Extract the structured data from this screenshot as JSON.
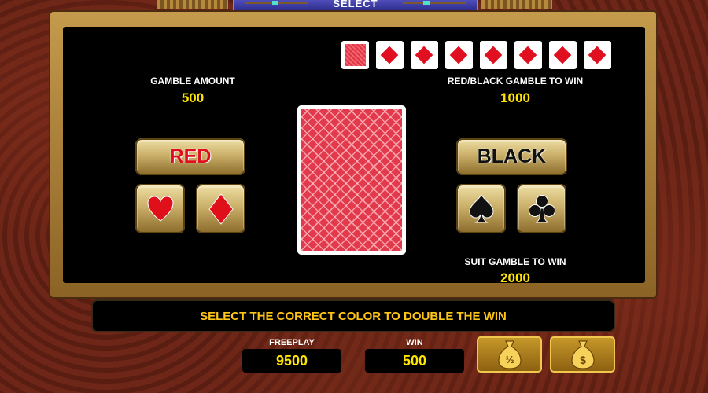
{
  "header": {
    "title": "SELECT"
  },
  "history_cards": [
    {
      "kind": "back"
    },
    {
      "kind": "diamond"
    },
    {
      "kind": "diamond"
    },
    {
      "kind": "diamond"
    },
    {
      "kind": "diamond"
    },
    {
      "kind": "diamond"
    },
    {
      "kind": "diamond"
    },
    {
      "kind": "diamond"
    }
  ],
  "gamble_amount": {
    "label": "GAMBLE AMOUNT",
    "value": "500"
  },
  "red_black": {
    "label": "RED/BLACK GAMBLE TO WIN",
    "value": "1000"
  },
  "suit_gamble": {
    "label": "SUIT GAMBLE TO WIN",
    "value": "2000"
  },
  "buttons": {
    "red": "RED",
    "black": "BLACK",
    "hearts_icon": "heart-icon",
    "diamonds_icon": "diamond-icon",
    "spades_icon": "spade-icon",
    "clubs_icon": "club-icon"
  },
  "message": "SELECT THE CORRECT COLOR TO DOUBLE THE WIN",
  "freeplay": {
    "label": "FREEPLAY",
    "value": "9500"
  },
  "win": {
    "label": "WIN",
    "value": "500"
  },
  "collect_buttons": {
    "half": "½",
    "full": "$"
  },
  "colors": {
    "accent_yellow": "#ffe400",
    "suit_red": "#e0101a",
    "gold": "#cbb06a"
  }
}
